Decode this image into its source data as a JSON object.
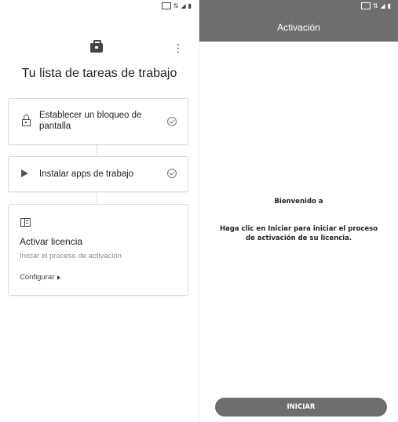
{
  "left": {
    "title": "Tu lista de tareas de trabajo",
    "tasks": [
      {
        "label": "Establecer un bloqueo de pantalla",
        "icon": "lock-icon",
        "completed": true
      },
      {
        "label": "Instalar apps de trabajo",
        "icon": "play-store-icon",
        "completed": true
      }
    ],
    "license_card": {
      "icon": "building-icon",
      "title": "Activar licencia",
      "subtitle": "Iniciar el proceso de activación",
      "link": "Configurar"
    }
  },
  "right": {
    "appbar_title": "Activación",
    "welcome": "Bienvenido a",
    "instructions": "Haga clic en Iniciar para iniciar el proceso de activación de su licencia.",
    "start_button": "INICIAR"
  },
  "colors": {
    "appbar": "#6f6f6f",
    "button": "#6e6e6e",
    "card_border": "#dcdcdc"
  }
}
